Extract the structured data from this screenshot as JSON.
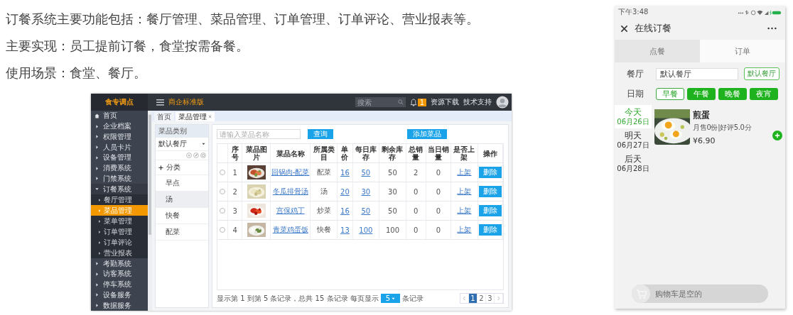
{
  "intro": [
    "订餐系统主要功能包括：餐厅管理、菜品管理、订单管理、订单评论、营业报表等。",
    "主要实现：员工提前订餐，食堂按需备餐。",
    "使用场景：食堂、餐厅。"
  ],
  "admin": {
    "logo": "食专调点",
    "edition": "商企标准版",
    "search": {
      "placeholder": "搜索"
    },
    "notifications": "1",
    "links": [
      "资源下载",
      "技术支持"
    ],
    "sidebar": [
      {
        "kind": "home",
        "label": "首页",
        "selected": false
      },
      {
        "kind": "group",
        "label": "企业档案",
        "selected": false,
        "expanded": false
      },
      {
        "kind": "group",
        "label": "权限管理",
        "selected": false,
        "expanded": false
      },
      {
        "kind": "group",
        "label": "人员卡片",
        "selected": false,
        "expanded": false
      },
      {
        "kind": "group",
        "label": "设备管理",
        "selected": false,
        "expanded": false
      },
      {
        "kind": "group",
        "label": "消费系统",
        "selected": false,
        "expanded": false
      },
      {
        "kind": "group",
        "label": "门禁系统",
        "selected": false,
        "expanded": false
      },
      {
        "kind": "group",
        "label": "订餐系统",
        "selected": false,
        "expanded": true,
        "children": [
          {
            "label": "餐厅管理",
            "selected": false
          },
          {
            "label": "菜品管理",
            "selected": true
          },
          {
            "label": "菜单管理",
            "selected": false
          },
          {
            "label": "订单管理",
            "selected": false
          },
          {
            "label": "订单评论",
            "selected": false
          },
          {
            "label": "营业报表",
            "selected": false
          }
        ]
      },
      {
        "kind": "group",
        "label": "考勤系统",
        "selected": false,
        "expanded": false
      },
      {
        "kind": "group",
        "label": "访客系统",
        "selected": false,
        "expanded": false
      },
      {
        "kind": "group",
        "label": "停车系统",
        "selected": false,
        "expanded": false
      },
      {
        "kind": "group",
        "label": "设备服务",
        "selected": false,
        "expanded": false
      },
      {
        "kind": "group",
        "label": "数据服务",
        "selected": false,
        "expanded": false
      }
    ],
    "tabs": [
      {
        "label": "首页",
        "selected": false,
        "closable": false
      },
      {
        "label": "菜品管理",
        "selected": true,
        "closable": true
      }
    ],
    "categories": {
      "title": "菜品类别",
      "restaurant": "默认餐厅",
      "root": "分类",
      "items": [
        {
          "label": "早点",
          "selected": false
        },
        {
          "label": "汤",
          "selected": true
        },
        {
          "label": "快餐",
          "selected": false
        },
        {
          "label": "配菜",
          "selected": false
        }
      ]
    },
    "dish_search": {
      "placeholder": "请输入菜品名称"
    },
    "query_button": "查询",
    "add_button": "添加菜品",
    "table": {
      "columns": [
        "序号",
        "菜品图片",
        "菜品名称",
        "所属类目",
        "单价",
        "每日库存",
        "剩余库存",
        "总销量",
        "当日销量",
        "是否上架",
        "操作"
      ],
      "rows": [
        {
          "selected": false,
          "no": "1",
          "name": "回锅肉-配菜",
          "category": "配菜",
          "price": "16",
          "daily_stock": "50",
          "remaining": "50",
          "total_sales": "2",
          "today_sales": "0",
          "listed": "上架",
          "action": "删除"
        },
        {
          "selected": false,
          "no": "2",
          "name": "冬瓜排骨汤",
          "category": "汤",
          "price": "20",
          "daily_stock": "30",
          "remaining": "30",
          "total_sales": "0",
          "today_sales": "0",
          "listed": "上架",
          "action": "删除"
        },
        {
          "selected": false,
          "no": "3",
          "name": "宫保鸡丁",
          "category": "炒菜",
          "price": "16",
          "daily_stock": "50",
          "remaining": "50",
          "total_sales": "0",
          "today_sales": "0",
          "listed": "上架",
          "action": "删除"
        },
        {
          "selected": false,
          "no": "4",
          "name": "青菜鸡蛋饭",
          "category": "快餐",
          "price": "13",
          "daily_stock": "100",
          "remaining": "100",
          "total_sales": "0",
          "today_sales": "0",
          "listed": "上架",
          "action": "删除"
        }
      ]
    },
    "footer": {
      "summary": "显示第 1 到第 5 条记录，总共 15 条记录 每页显示",
      "page_size": "5",
      "suffix": "条记录"
    },
    "pagination": [
      {
        "label": "1",
        "selected": true
      },
      {
        "label": "2",
        "selected": false
      },
      {
        "label": "3",
        "selected": false
      }
    ]
  },
  "mobile": {
    "time": "下午3:48",
    "title": "在线订餐",
    "tabs": [
      {
        "label": "点餐",
        "selected": true
      },
      {
        "label": "订单",
        "selected": false
      }
    ],
    "restaurant_label": "餐厅",
    "restaurant_value": "默认餐厅",
    "restaurant_button": "默认餐厅",
    "date_label": "日期",
    "meals": [
      {
        "label": "早餐",
        "selected": true
      },
      {
        "label": "午餐",
        "selected": false
      },
      {
        "label": "晚餐",
        "selected": false
      },
      {
        "label": "夜宵",
        "selected": false
      }
    ],
    "days": [
      {
        "label": "今天",
        "date": "06月26日",
        "selected": true
      },
      {
        "label": "明天",
        "date": "06月27日",
        "selected": false
      },
      {
        "label": "后天",
        "date": "06月28日",
        "selected": false
      }
    ],
    "dish": {
      "name": "煎蛋",
      "stats": "月售0份|好评5.0分",
      "price": "¥6.90"
    },
    "cart": "购物车是空的"
  }
}
